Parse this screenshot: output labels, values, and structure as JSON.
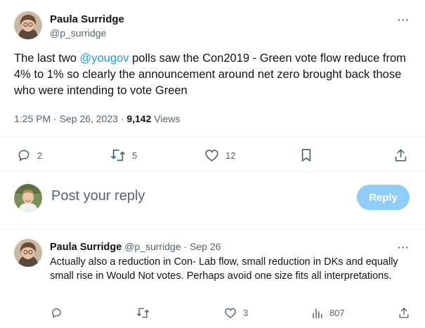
{
  "tweet": {
    "author_name": "Paula Surridge",
    "author_handle": "@p_surridge",
    "text_before": "The last two ",
    "mention": "@yougov",
    "text_after": " polls saw the Con2019 - Green vote flow reduce from 4% to 1% so clearly the announcement around net zero brought back those who were intending to vote Green",
    "time": "1:25 PM",
    "date": "Sep 26, 2023",
    "separator": "·",
    "views_count": "9,142",
    "views_label": "Views",
    "more": "···",
    "actions": {
      "replies": "2",
      "retweets": "5",
      "likes": "12"
    }
  },
  "composer": {
    "placeholder": "Post your reply",
    "button_label": "Reply"
  },
  "reply": {
    "author_name": "Paula Surridge",
    "author_handle": "@p_surridge",
    "separator": "·",
    "date": "Sep 26",
    "text": "Actually also a reduction in Con- Lab flow, small reduction in DKs and equally small rise in Would Not votes. Perhaps avoid one size fits all interpretations.",
    "more": "···",
    "actions": {
      "replies": "",
      "retweets": "",
      "likes": "3",
      "views": "807"
    }
  },
  "icons": {
    "reply": "speech-bubble-icon",
    "retweet": "retweet-icon",
    "like": "heart-icon",
    "bookmark": "bookmark-icon",
    "share": "share-icon",
    "analytics": "bar-chart-icon"
  },
  "colors": {
    "accent": "#1d9bf0",
    "reply_button": "#8ecdf8",
    "secondary_text": "#536471"
  }
}
